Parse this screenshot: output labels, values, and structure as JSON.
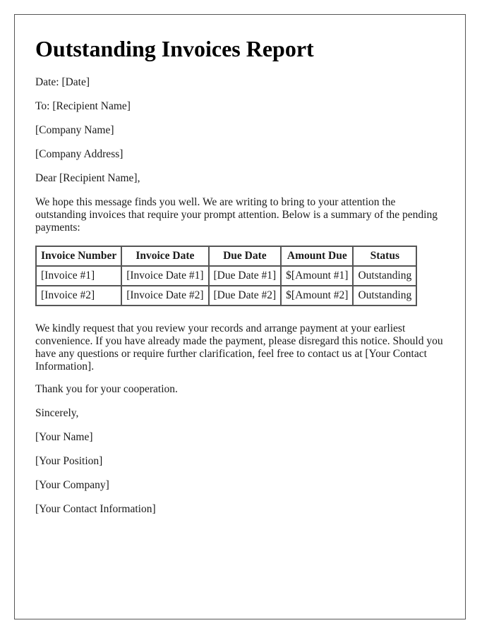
{
  "title": "Outstanding Invoices Report",
  "header_lines": {
    "date": "Date: [Date]",
    "to": "To: [Recipient Name]",
    "company": "[Company Name]",
    "address": "[Company Address]",
    "salutation": "Dear [Recipient Name],"
  },
  "intro": "We hope this message finds you well. We are writing to bring to your attention the outstanding invoices that require your prompt attention. Below is a summary of the pending payments:",
  "table": {
    "headers": [
      "Invoice Number",
      "Invoice Date",
      "Due Date",
      "Amount Due",
      "Status"
    ],
    "rows": [
      [
        "[Invoice #1]",
        "[Invoice Date #1]",
        "[Due Date #1]",
        "$[Amount #1]",
        "Outstanding"
      ],
      [
        "[Invoice #2]",
        "[Invoice Date #2]",
        "[Due Date #2]",
        "$[Amount #2]",
        "Outstanding"
      ]
    ]
  },
  "request": "We kindly request that you review your records and arrange payment at your earliest convenience. If you have already made the payment, please disregard this notice. Should you have any questions or require further clarification, feel free to contact us at [Your Contact Information].",
  "thanks": "Thank you for your cooperation.",
  "closing": "Sincerely,",
  "signature": {
    "name": "[Your Name]",
    "position": "[Your Position]",
    "company": "[Your Company]",
    "contact": "[Your Contact Information]"
  }
}
